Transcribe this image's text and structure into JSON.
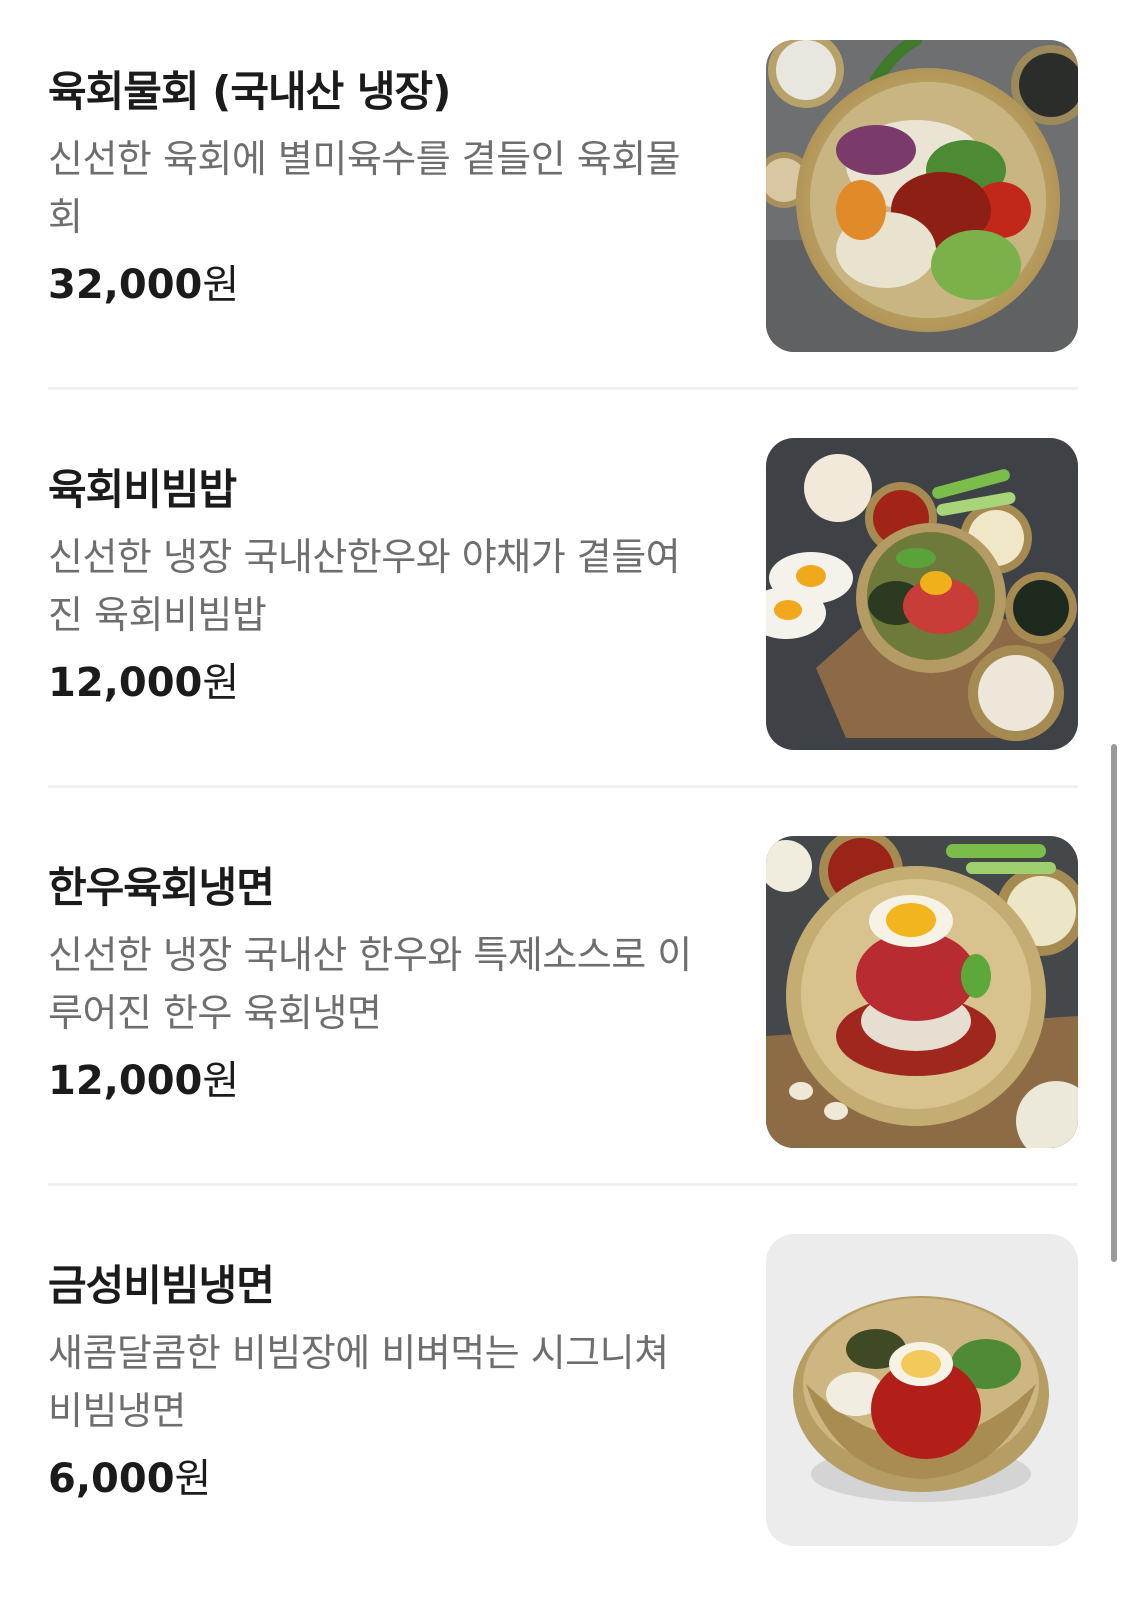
{
  "menu_items": [
    {
      "name": "육회물회 (국내산 냉장)",
      "description": "신선한 육회에 별미육수를 곁들인 육회물회",
      "price": "32,000",
      "currency": "원",
      "image": "yukhoe-mulhoe-photo"
    },
    {
      "name": "육회비빔밥",
      "description": "신선한 냉장 국내산한우와 야채가 곁들여진 육회비빔밥",
      "price": "12,000",
      "currency": "원",
      "image": "yukhoe-bibimbap-photo"
    },
    {
      "name": "한우육회냉면",
      "description": "신선한 냉장 국내산 한우와 특제소스로 이루어진 한우 육회냉면",
      "price": "12,000",
      "currency": "원",
      "image": "hanwoo-yukhoe-naengmyeon-photo"
    },
    {
      "name": "금성비빔냉면",
      "description": "새콤달콤한 비빔장에 비벼먹는 시그니쳐 비빔냉면",
      "price": "6,000",
      "currency": "원",
      "image": "geumseong-bibim-naengmyeon-photo"
    }
  ],
  "colors": {
    "title": "#1b1b1b",
    "description": "#6e6e6e",
    "divider": "#f1f1f1",
    "scrollbar": "#9a9a9a"
  }
}
